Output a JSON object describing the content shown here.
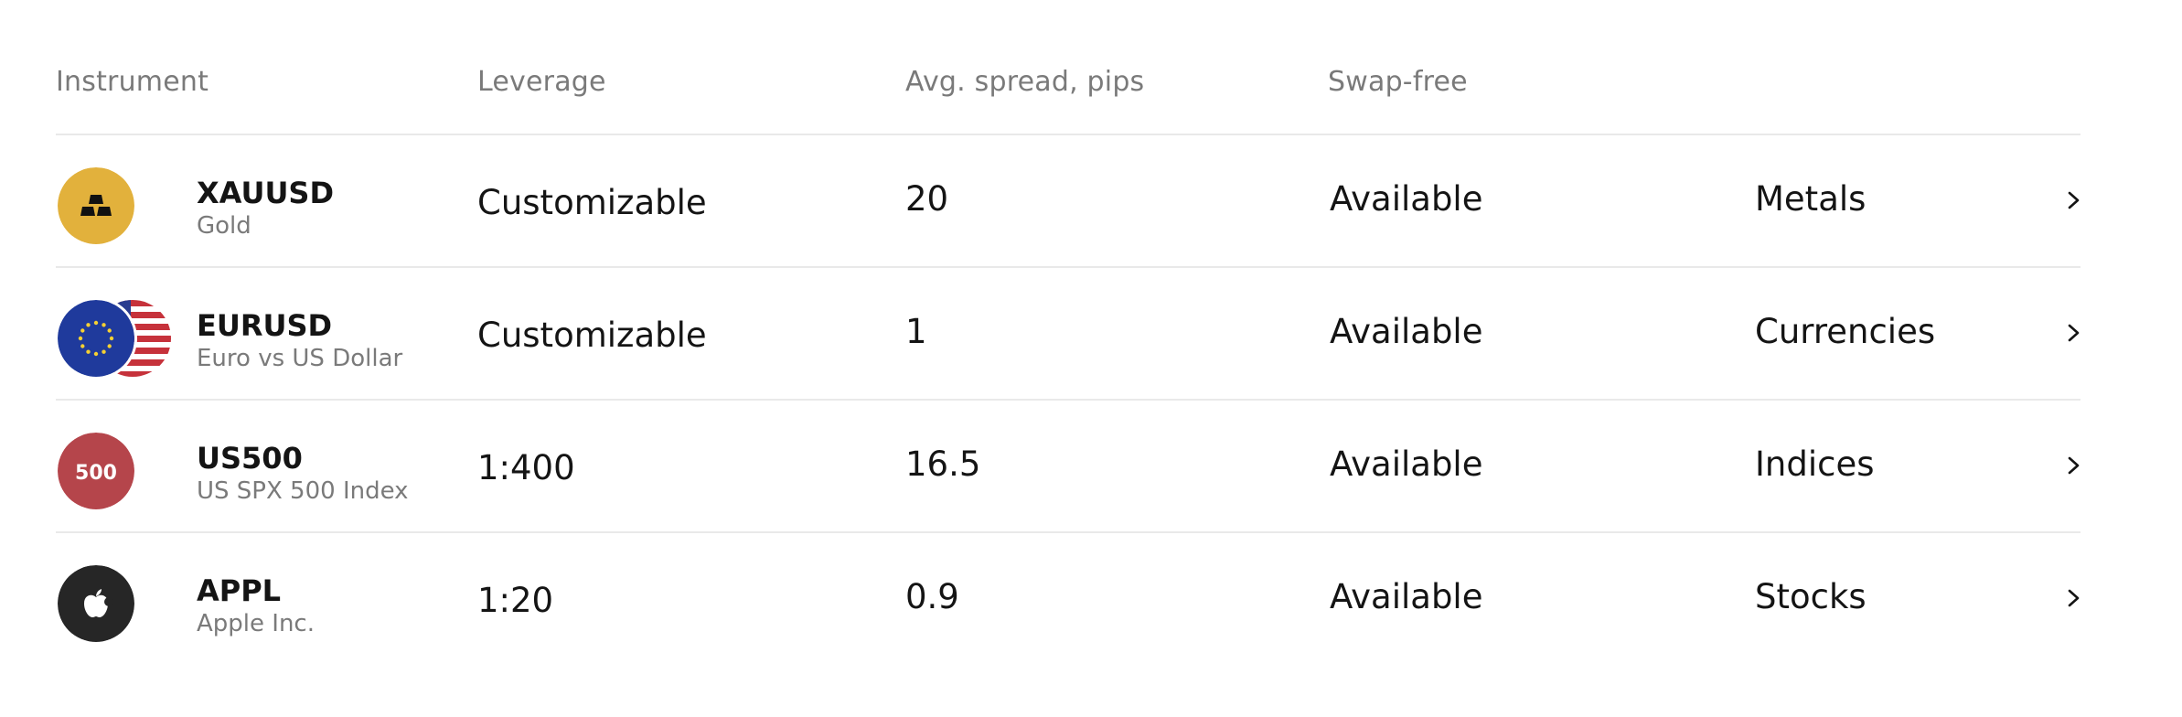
{
  "headers": {
    "instrument": "Instrument",
    "leverage": "Leverage",
    "spread": "Avg. spread, pips",
    "swap": "Swap-free"
  },
  "rows": [
    {
      "symbol": "XAUUSD",
      "name": "Gold",
      "leverage": "Customizable",
      "spread": "20",
      "swap": "Available",
      "category": "Metals",
      "icon": "gold-bars-icon",
      "icon_color": "#e2b13c"
    },
    {
      "symbol": "EURUSD",
      "name": "Euro vs US Dollar",
      "leverage": "Customizable",
      "spread": "1",
      "swap": "Available",
      "category": "Currencies",
      "icon": "eu-flag-icon",
      "icon_color": "#1f3a9c"
    },
    {
      "symbol": "US500",
      "name": "US SPX 500 Index",
      "leverage": "1:400",
      "spread": "16.5",
      "swap": "Available",
      "category": "Indices",
      "icon": "us500-badge-icon",
      "icon_color": "#b5454b",
      "icon_text": "500"
    },
    {
      "symbol": "APPL",
      "name": "Apple Inc.",
      "leverage": "1:20",
      "spread": "0.9",
      "swap": "Available",
      "category": "Stocks",
      "icon": "apple-logo-icon",
      "icon_color": "#262626"
    }
  ],
  "colors": {
    "text_primary": "#141414",
    "text_secondary": "#7a7a7a",
    "divider": "#e9e9e9"
  }
}
